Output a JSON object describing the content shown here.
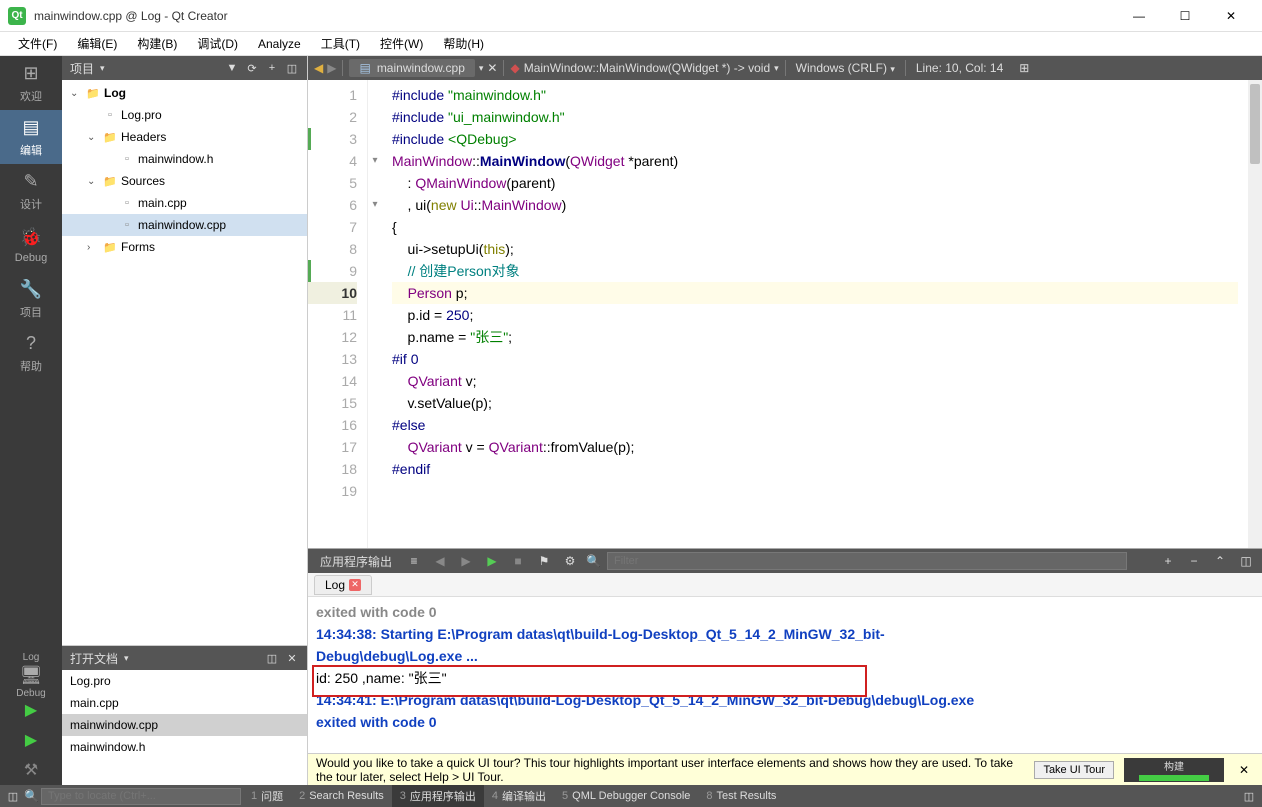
{
  "window": {
    "title": "mainwindow.cpp @ Log - Qt Creator"
  },
  "menu": {
    "items": [
      "文件(F)",
      "编辑(E)",
      "构建(B)",
      "调试(D)",
      "Analyze",
      "工具(T)",
      "控件(W)",
      "帮助(H)"
    ]
  },
  "modebar": {
    "items": [
      {
        "label": "欢迎",
        "icon": "⊞"
      },
      {
        "label": "编辑",
        "icon": "▤",
        "active": true
      },
      {
        "label": "设计",
        "icon": "✎"
      },
      {
        "label": "Debug",
        "icon": "🐞"
      },
      {
        "label": "项目",
        "icon": "🔧"
      },
      {
        "label": "帮助",
        "icon": "?"
      }
    ],
    "build": {
      "label1": "Log",
      "label2": "Debug",
      "icon": "🖥"
    },
    "run_icons": [
      "▶",
      "▶",
      "⚒"
    ]
  },
  "project_panel": {
    "title": "项目",
    "tree": [
      {
        "depth": 0,
        "arrow": "⌄",
        "icon": "folder",
        "label": "Log",
        "bold": true
      },
      {
        "depth": 1,
        "arrow": "",
        "icon": "file",
        "label": "Log.pro"
      },
      {
        "depth": 1,
        "arrow": "⌄",
        "icon": "folder",
        "label": "Headers"
      },
      {
        "depth": 2,
        "arrow": "",
        "icon": "file",
        "label": "mainwindow.h"
      },
      {
        "depth": 1,
        "arrow": "⌄",
        "icon": "folder",
        "label": "Sources"
      },
      {
        "depth": 2,
        "arrow": "",
        "icon": "file",
        "label": "main.cpp"
      },
      {
        "depth": 2,
        "arrow": "",
        "icon": "file",
        "label": "mainwindow.cpp",
        "selected": true
      },
      {
        "depth": 1,
        "arrow": "›",
        "icon": "folder",
        "label": "Forms"
      }
    ]
  },
  "open_docs": {
    "title": "打开文档",
    "items": [
      {
        "label": "Log.pro"
      },
      {
        "label": "main.cpp"
      },
      {
        "label": "mainwindow.cpp",
        "selected": true
      },
      {
        "label": "mainwindow.h"
      }
    ]
  },
  "editor_toolbar": {
    "tab_label": "mainwindow.cpp",
    "symbol": "MainWindow::MainWindow(QWidget *) -> void",
    "encoding": "Windows (CRLF)",
    "position": "Line: 10, Col: 14"
  },
  "code": {
    "current_line": 10,
    "marked_lines": [
      3,
      9
    ],
    "lines": [
      {
        "n": 1,
        "html": "<span class='tok-pre'>#include</span> <span class='tok-inc'>\"mainwindow.h\"</span>"
      },
      {
        "n": 2,
        "html": "<span class='tok-pre'>#include</span> <span class='tok-inc'>\"ui_mainwindow.h\"</span>"
      },
      {
        "n": 3,
        "html": "<span class='tok-pre'>#include</span> <span class='tok-inc'>&lt;QDebug&gt;</span>"
      },
      {
        "n": 4,
        "html": "<span class='tok-type'>MainWindow</span>::<span class='tok-func'>MainWindow</span>(<span class='tok-type'>QWidget</span> *parent)"
      },
      {
        "n": 5,
        "html": "    : <span class='tok-type'>QMainWindow</span>(parent)"
      },
      {
        "n": 6,
        "html": "    , ui(<span class='tok-kw'>new</span> <span class='tok-type'>Ui</span>::<span class='tok-type'>MainWindow</span>)"
      },
      {
        "n": 7,
        "html": "{"
      },
      {
        "n": 8,
        "html": "    ui-&gt;setupUi(<span class='tok-kw'>this</span>);"
      },
      {
        "n": 9,
        "html": "    <span class='tok-comment'>// 创建Person对象</span>"
      },
      {
        "n": 10,
        "html": "    <span class='tok-type'>Person</span> p;"
      },
      {
        "n": 11,
        "html": "    p.id = <span class='tok-pre'>250</span>;"
      },
      {
        "n": 12,
        "html": "    p.name = <span class='tok-str'>\"张三\"</span>;"
      },
      {
        "n": 13,
        "html": "<span class='tok-pre'>#if</span> <span class='tok-pre'>0</span>"
      },
      {
        "n": 14,
        "html": "    <span class='tok-type'>QVariant</span> v;"
      },
      {
        "n": 15,
        "html": "    v.setValue(p);"
      },
      {
        "n": 16,
        "html": "<span class='tok-pre'>#else</span>"
      },
      {
        "n": 17,
        "html": "    <span class='tok-type'>QVariant</span> v = <span class='tok-type'>QVariant</span>::fromValue(p);"
      },
      {
        "n": 18,
        "html": "<span class='tok-pre'>#endif</span>"
      },
      {
        "n": 19,
        "html": ""
      }
    ]
  },
  "output": {
    "title": "应用程序输出",
    "filter_placeholder": "Filter",
    "tab_label": "Log",
    "lines": [
      {
        "cls": "out-gray",
        "text": "exited with code 0"
      },
      {
        "cls": "",
        "text": " "
      },
      {
        "cls": "out-blue",
        "text": "14:34:38: Starting E:\\Program datas\\qt\\build-Log-Desktop_Qt_5_14_2_MinGW_32_bit-"
      },
      {
        "cls": "out-blue",
        "text": "Debug\\debug\\Log.exe ..."
      },
      {
        "cls": "out-black",
        "text": "id:  250 ,name:  \"张三\""
      },
      {
        "cls": "out-blue",
        "text": "14:34:41: E:\\Program datas\\qt\\build-Log-Desktop_Qt_5_14_2_MinGW_32_bit-Debug\\debug\\Log.exe"
      },
      {
        "cls": "out-blue",
        "text": "exited with code 0"
      }
    ]
  },
  "banner": {
    "text": "Would you like to take a quick UI tour? This tour highlights important user interface elements and shows how they are used. To take the tour later, select Help > UI Tour.",
    "button": "Take UI Tour",
    "build_label": "构建"
  },
  "bottombar": {
    "locator_placeholder": "Type to locate (Ctrl+...",
    "items": [
      {
        "num": "1",
        "label": "问题"
      },
      {
        "num": "2",
        "label": "Search Results"
      },
      {
        "num": "3",
        "label": "应用程序输出",
        "active": true
      },
      {
        "num": "4",
        "label": "编译输出"
      },
      {
        "num": "5",
        "label": "QML Debugger Console"
      },
      {
        "num": "8",
        "label": "Test Results"
      }
    ]
  }
}
